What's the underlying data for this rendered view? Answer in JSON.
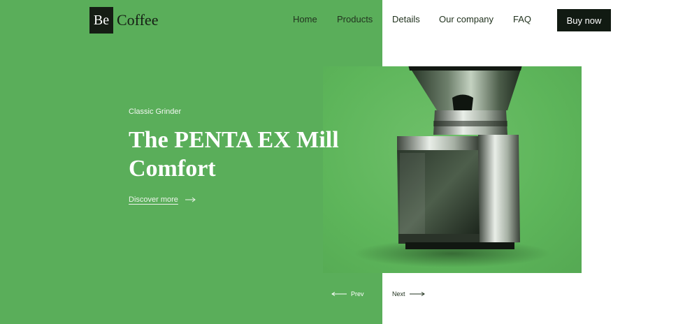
{
  "brand": {
    "mark": "Be",
    "name": "Coffee"
  },
  "nav": {
    "items": [
      {
        "label": "Home"
      },
      {
        "label": "Products"
      },
      {
        "label": "Details"
      },
      {
        "label": "Our company"
      },
      {
        "label": "FAQ"
      }
    ],
    "cta": "Buy now"
  },
  "hero": {
    "eyebrow": "Classic Grinder",
    "title": "The PENTA EX Mill Comfort",
    "link": "Discover more",
    "image_alt": "coffee grinder"
  },
  "pager": {
    "prev": "Prev",
    "next": "Next"
  },
  "colors": {
    "primary_green": "#5aae5a",
    "image_green": "#63b760",
    "dark": "#111a12",
    "white": "#ffffff"
  },
  "icons": [
    "arrow-right-icon",
    "arrow-left-icon"
  ]
}
